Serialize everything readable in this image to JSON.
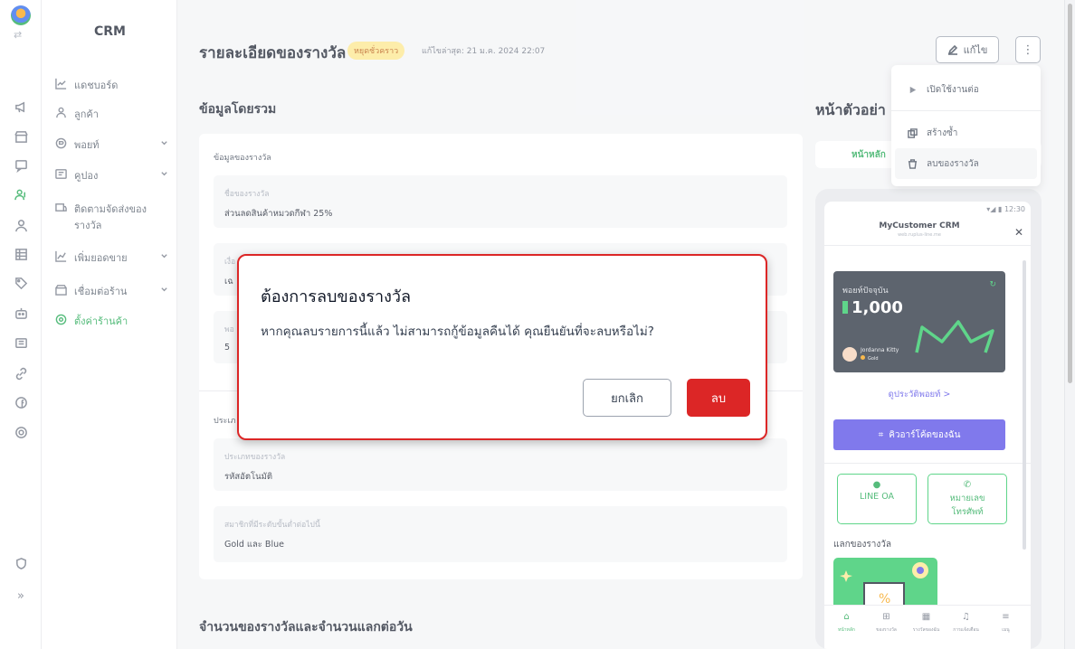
{
  "brand": "CRM",
  "sidebar": {
    "items": [
      {
        "label": "แดชบอร์ด",
        "icon": "chart-line-icon"
      },
      {
        "label": "ลูกค้า",
        "icon": "users-icon"
      },
      {
        "label": "พอยท์",
        "icon": "points-icon"
      },
      {
        "label": "คูปอง",
        "icon": "coupon-icon"
      },
      {
        "label": "ติดตามจัดส่งของรางวัล",
        "icon": "delivery-tracking-icon"
      },
      {
        "label": "เพิ่มยอดขาย",
        "icon": "sales-growth-icon"
      },
      {
        "label": "เชื่อมต่อร้าน",
        "icon": "store-connect-icon"
      },
      {
        "label": "ตั้งค่าร้านค้า",
        "icon": "gear-icon"
      }
    ]
  },
  "header": {
    "title": "รายละเอียดของรางวัล",
    "status_badge": "หยุดชั่วคราว",
    "last_edited": "แก้ไขล่าสุด: 21 ม.ค. 2024 22:07",
    "edit_label": "แก้ไข",
    "more_label": "⋮"
  },
  "overview": {
    "section_title": "ข้อมูลโดยรวม",
    "card_title": "ข้อมูลของรางวัล",
    "name_label": "ชื่อของรางวัล",
    "name_value": "ส่วนลดสินค้าหมวดกีฬา 25%",
    "condition_label_partial": "เงื่อ",
    "condition_value_partial": "เฉ",
    "points_label_partial": "พอ",
    "points_value_partial": "5",
    "type_card_title_partial": "ประเภ",
    "type_label": "ประเภทของรางวัล",
    "type_value": "รหัสอัตโนมัติ",
    "tier_label": "สมาชิกที่มีระดับขั้นต่ำต่อไปนี้",
    "tier_value": "Gold และ Blue",
    "next_section_title": "จำนวนของรางวัลและจำนวนแลกต่อวัน"
  },
  "preview": {
    "title_partial": "หน้าตัวอย่า",
    "tab_home": "หน้าหลัก",
    "status_time": "12:30",
    "app_name": "MyCustomer CRM",
    "app_url": "web.ruplus-line.me",
    "points_label": "พอยท์ปัจจุบัน",
    "points_value": "1,000",
    "user_name": "Jordanna Kitty",
    "user_tier": "Gold",
    "history_link": "ดูประวัติพอยท์ >",
    "qr_button": "คิวอาร์โค้ดของฉัน",
    "line_oa": "LINE OA",
    "phone_btn_line1": "หมายเลข",
    "phone_btn_line2": "โทรศัพท์",
    "redeem_title": "แลกของรางวัล",
    "bottom_nav": [
      {
        "label": "หน้าหลัก",
        "icon": "home-icon"
      },
      {
        "label": "ของรางวัล",
        "icon": "gift-icon"
      },
      {
        "label": "รางวัลของฉัน",
        "icon": "calendar-gift-icon"
      },
      {
        "label": "การแจ้งเตือน",
        "icon": "bell-icon"
      },
      {
        "label": "เมนู",
        "icon": "menu-icon"
      }
    ]
  },
  "dropdown": {
    "items": [
      {
        "label": "เปิดใช้งานต่อ",
        "icon": "play-icon"
      },
      {
        "label": "สร้างซ้ำ",
        "icon": "duplicate-icon"
      },
      {
        "label": "ลบของรางวัล",
        "icon": "trash-icon"
      }
    ]
  },
  "modal": {
    "title": "ต้องการลบของรางวัล",
    "message": "หากคุณลบรายการนี้แล้ว ไม่สามารถกู้ข้อมูลคืนได้ คุณยืนยันที่จะลบหรือไม่?",
    "cancel_label": "ยกเลิก",
    "delete_label": "ลบ"
  },
  "colors": {
    "accent": "#16a34a",
    "danger": "#dc2626",
    "primary_button": "#4f46e5",
    "badge_bg": "#fde68a"
  }
}
